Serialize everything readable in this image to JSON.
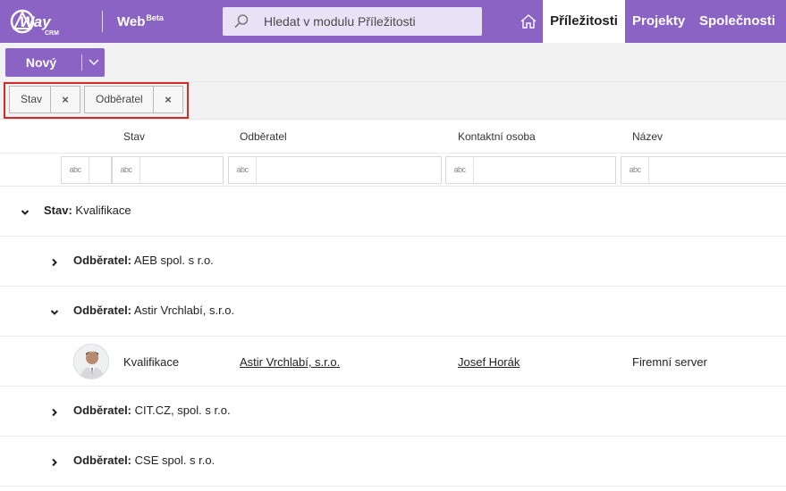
{
  "header": {
    "logo_text": "eWay",
    "logo_subtext": "CRM",
    "web_label": "Web",
    "web_badge": "Beta",
    "search_placeholder": "Hledat v modulu Příležitosti",
    "nav": [
      "Příležitosti",
      "Projekty",
      "Společnosti"
    ],
    "active_nav": "Příležitosti",
    "brand_color": "#8a63c4"
  },
  "toolbar": {
    "new_label": "Nový"
  },
  "grouping": {
    "chips": [
      {
        "label": "Stav",
        "remove": "×"
      },
      {
        "label": "Odběratel",
        "remove": "×"
      }
    ],
    "highlight_color": "#d22b2b"
  },
  "columns": [
    "Stav",
    "Odběratel",
    "Kontaktní osoba",
    "Název"
  ],
  "filter_icon_text": "abc",
  "groups": [
    {
      "level": 1,
      "expanded": true,
      "key": "Stav:",
      "value": "Kvalifikace"
    },
    {
      "level": 2,
      "expanded": false,
      "key": "Odběratel:",
      "value": "AEB spol. s r.o."
    },
    {
      "level": 2,
      "expanded": true,
      "key": "Odběratel:",
      "value": "Astir Vrchlabí, s.r.o."
    },
    {
      "record": true,
      "stav": "Kvalifikace",
      "odberatel": "Astir Vrchlabí, s.r.o.",
      "kontakt": "Josef Horák",
      "nazev": "Firemní server"
    },
    {
      "level": 2,
      "expanded": false,
      "key": "Odběratel:",
      "value": "CIT.CZ, spol. s r.o."
    },
    {
      "level": 2,
      "expanded": false,
      "key": "Odběratel:",
      "value": "CSE spol. s r.o."
    }
  ]
}
